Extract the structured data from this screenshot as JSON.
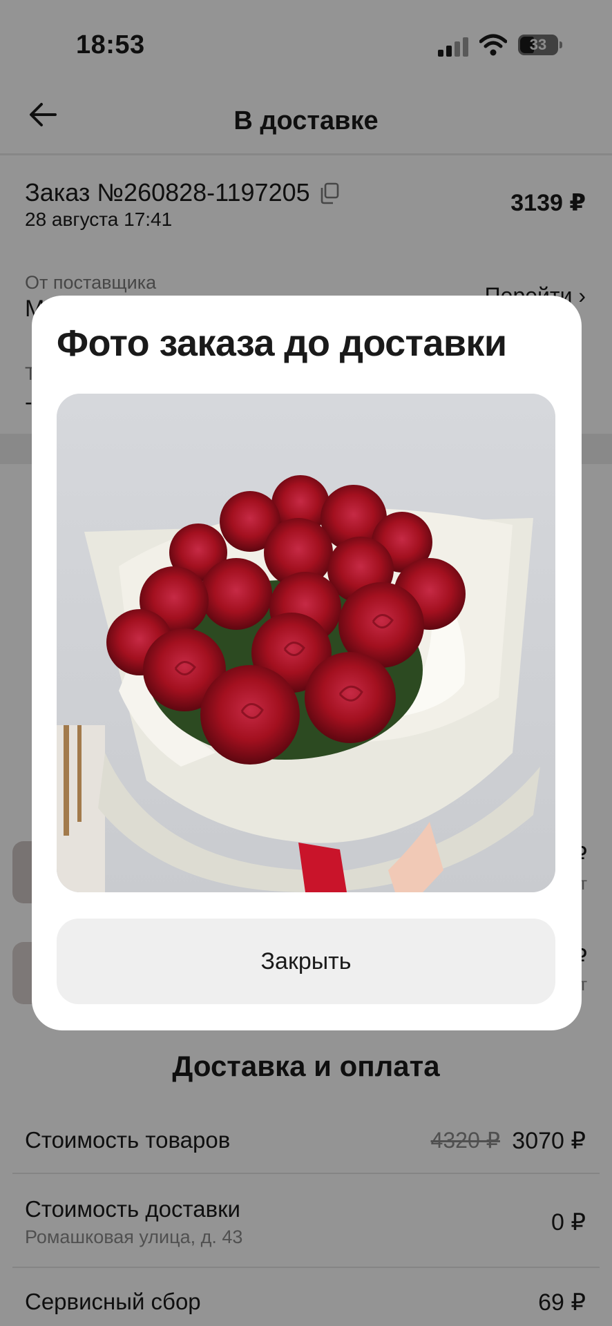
{
  "status_bar": {
    "time": "18:53",
    "battery": "33"
  },
  "header": {
    "title": "В доставке"
  },
  "order": {
    "number": "Заказ №260828-1197205",
    "date": "28 августа 17:41",
    "price": "3139 ₽",
    "supplier_label": "От поставщика",
    "supplier_name": "М",
    "goto_label": "Перейти",
    "row3_label": "Т",
    "row3_value": "-"
  },
  "items": [
    {
      "edge_value": "₽",
      "edge_sub": "т"
    },
    {
      "edge_value": "₽",
      "edge_sub": "т"
    }
  ],
  "payment": {
    "title": "Доставка и оплата",
    "rows": [
      {
        "label": "Стоимость товаров",
        "old_value": "4320 ₽",
        "value": "3070 ₽"
      },
      {
        "label": "Стоимость доставки",
        "sub": "Ромашковая улица, д. 43",
        "value": "0 ₽"
      },
      {
        "label": "Сервисный сбор",
        "value": "69 ₽"
      }
    ]
  },
  "modal": {
    "title": "Фото заказа до доставки",
    "close_label": "Закрыть"
  }
}
